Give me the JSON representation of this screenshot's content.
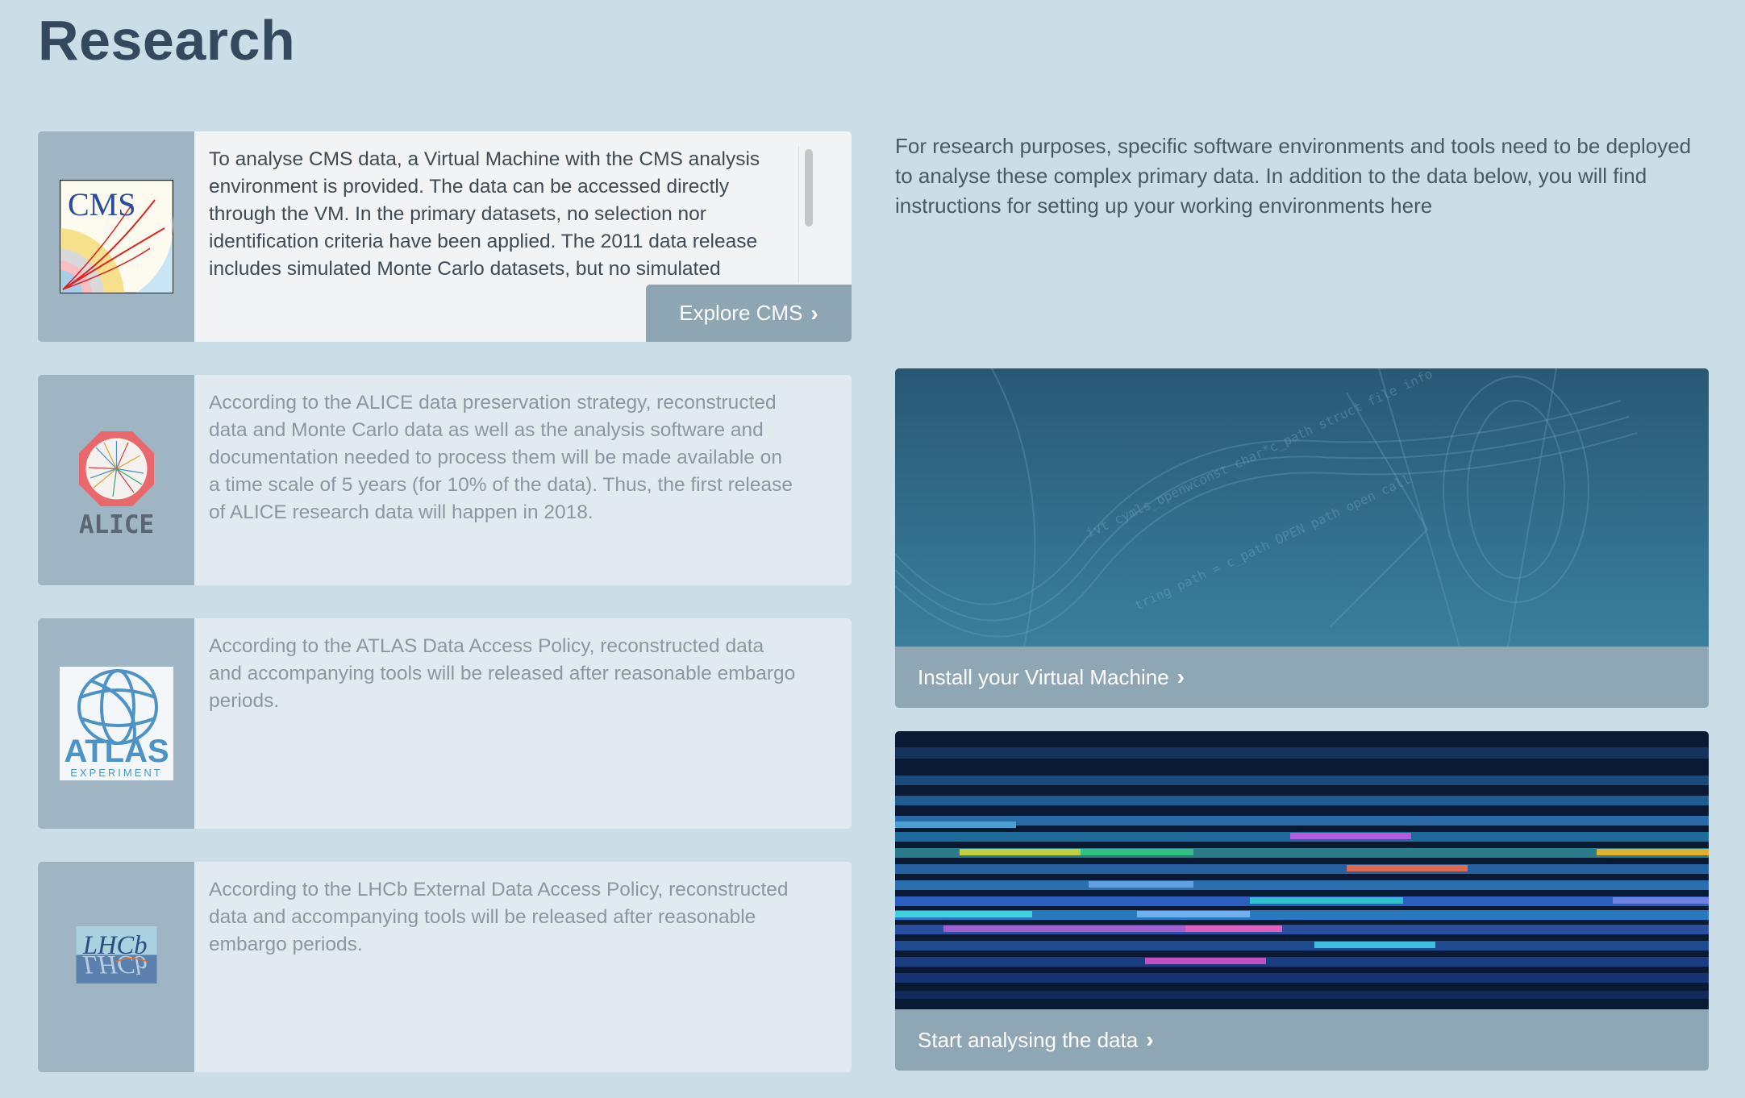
{
  "page": {
    "title": "Research"
  },
  "intro": "For research purposes, specific software environments and tools need to be deployed to analyse these complex primary data. In addition to the data below, you will find instructions for setting up your working environments here",
  "experiments": [
    {
      "name": "CMS",
      "logo_text": "CMS",
      "description": "To analyse CMS data, a Virtual Machine with the CMS analysis environment is provided. The data can be accessed directly through the VM. In the primary datasets, no selection nor identification criteria have been applied. The 2011 data release includes simulated Monte Carlo datasets, but no simulated datasets are provided for",
      "button_label": "Explore CMS"
    },
    {
      "name": "ALICE",
      "logo_text": "ALICE",
      "description": "According to the ALICE data preservation strategy, reconstructed data and Monte Carlo data as well as the analysis software and documentation needed to process them will be made available on a time scale of 5 years (for 10% of the data). Thus, the first release of ALICE research data will happen in 2018."
    },
    {
      "name": "ATLAS",
      "logo_text": "ATLAS",
      "logo_subtext": "EXPERIMENT",
      "description": "According to the ATLAS Data Access Policy, reconstructed data and accompanying tools will be released after reasonable embargo periods."
    },
    {
      "name": "LHCb",
      "logo_text": "LHCb",
      "description": "According to the LHCb External Data Access Policy, reconstructed data and accompanying tools will be released after reasonable embargo periods."
    }
  ],
  "features": [
    {
      "label": "Install your Virtual Machine"
    },
    {
      "label": "Start analysing the data"
    }
  ],
  "icons": {
    "chevron": "chevron-right-icon"
  },
  "colors": {
    "background": "#cbdde6",
    "card": "#e1eaef",
    "logo_column": "#9fb5c4",
    "button": "#8ea5b4",
    "title": "#34495e"
  }
}
